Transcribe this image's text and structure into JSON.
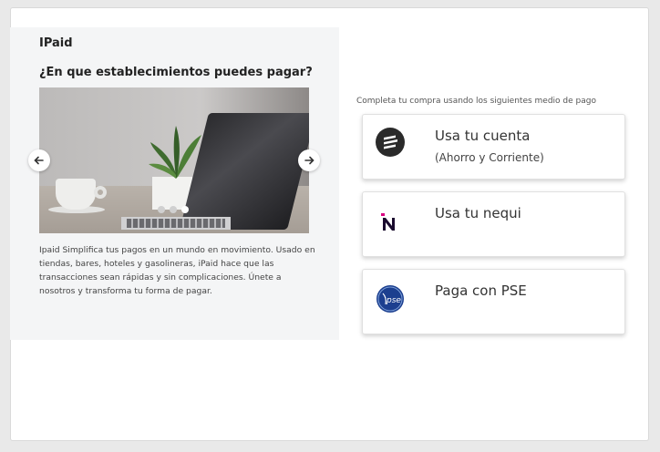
{
  "left_panel": {
    "brand": "IPaid",
    "question": "¿En que establecimientos puedes pagar?",
    "description": "Ipaid Simplifica tus pagos en un mundo en movimiento. Usado en tiendas, bares, hoteles y gasolineras, iPaid hace que las transacciones sean rápidas y sin complicaciones. Únete a nosotros y transforma tu forma de pagar.",
    "carousel": {
      "slides": 3,
      "active_slide": 3,
      "prev_icon": "arrow-left-icon",
      "next_icon": "arrow-right-icon"
    }
  },
  "right_panel": {
    "instruction": "Completa tu compra usando los siguientes medio de pago",
    "options": [
      {
        "label": "Usa tu cuenta",
        "sub": "(Ahorro y Corriente)",
        "icon": "bank-account-icon"
      },
      {
        "label": "Usa tu nequi",
        "sub": "",
        "icon": "nequi-logo-icon"
      },
      {
        "label": "Paga con PSE",
        "sub": "",
        "icon": "pse-logo-icon"
      }
    ]
  },
  "colors": {
    "page_bg": "#e9e9e9",
    "panel_bg": "#f4f5f6",
    "nequi_accent": "#da0081",
    "pse_blue": "#1c3f8f"
  }
}
